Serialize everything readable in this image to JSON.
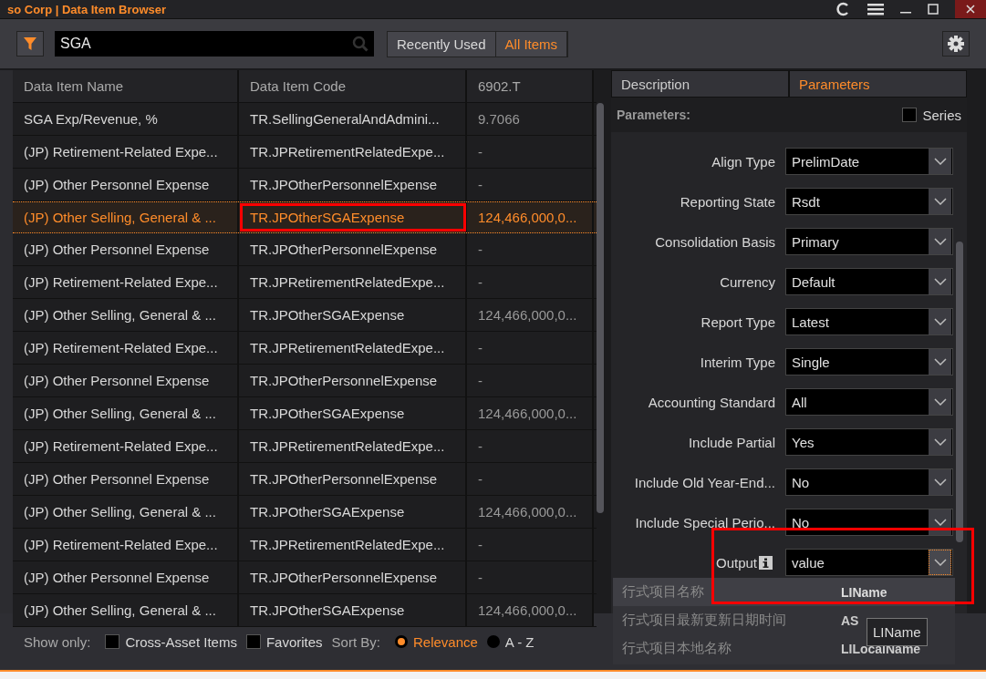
{
  "window": {
    "title": "so Corp | Data Item Browser"
  },
  "search": {
    "value": "SGA"
  },
  "views": [
    {
      "label": "Recently Used",
      "selected": false
    },
    {
      "label": "All Items",
      "selected": true
    }
  ],
  "table": {
    "columns": [
      "Data Item Name",
      "Data Item Code",
      "6902.T"
    ],
    "rows": [
      {
        "cells": [
          "SGA Exp/Revenue, %",
          "TR.SellingGeneralAndAdmini...",
          "9.7066"
        ],
        "selected": false,
        "highlighted": false
      },
      {
        "cells": [
          "(JP) Retirement-Related Expe...",
          "TR.JPRetirementRelatedExpe...",
          "-"
        ],
        "selected": false,
        "highlighted": false
      },
      {
        "cells": [
          "(JP) Other Personnel Expense",
          "TR.JPOtherPersonnelExpense",
          "-"
        ],
        "selected": false,
        "highlighted": false
      },
      {
        "cells": [
          "(JP) Other Selling, General & ...",
          "TR.JPOtherSGAExpense",
          "124,466,000,0..."
        ],
        "selected": true,
        "highlighted": true
      },
      {
        "cells": [
          "(JP) Other Personnel Expense",
          "TR.JPOtherPersonnelExpense",
          "-"
        ],
        "selected": false,
        "highlighted": false
      },
      {
        "cells": [
          "(JP) Retirement-Related Expe...",
          "TR.JPRetirementRelatedExpe...",
          "-"
        ],
        "selected": false,
        "highlighted": false
      },
      {
        "cells": [
          "(JP) Other Selling, General & ...",
          "TR.JPOtherSGAExpense",
          "124,466,000,0..."
        ],
        "selected": false,
        "highlighted": false
      },
      {
        "cells": [
          "(JP) Retirement-Related Expe...",
          "TR.JPRetirementRelatedExpe...",
          "-"
        ],
        "selected": false,
        "highlighted": false
      },
      {
        "cells": [
          "(JP) Other Personnel Expense",
          "TR.JPOtherPersonnelExpense",
          "-"
        ],
        "selected": false,
        "highlighted": false
      },
      {
        "cells": [
          "(JP) Other Selling, General & ...",
          "TR.JPOtherSGAExpense",
          "124,466,000,0..."
        ],
        "selected": false,
        "highlighted": false
      },
      {
        "cells": [
          "(JP) Retirement-Related Expe...",
          "TR.JPRetirementRelatedExpe...",
          "-"
        ],
        "selected": false,
        "highlighted": false
      },
      {
        "cells": [
          "(JP) Other Personnel Expense",
          "TR.JPOtherPersonnelExpense",
          "-"
        ],
        "selected": false,
        "highlighted": false
      },
      {
        "cells": [
          "(JP) Other Selling, General & ...",
          "TR.JPOtherSGAExpense",
          "124,466,000,0..."
        ],
        "selected": false,
        "highlighted": false
      },
      {
        "cells": [
          "(JP) Retirement-Related Expe...",
          "TR.JPRetirementRelatedExpe...",
          "-"
        ],
        "selected": false,
        "highlighted": false
      },
      {
        "cells": [
          "(JP) Other Personnel Expense",
          "TR.JPOtherPersonnelExpense",
          "-"
        ],
        "selected": false,
        "highlighted": false
      },
      {
        "cells": [
          "(JP) Other Selling, General & ...",
          "TR.JPOtherSGAExpense",
          "124,466,000,0..."
        ],
        "selected": false,
        "highlighted": false
      }
    ]
  },
  "detail_tabs": [
    {
      "label": "Description",
      "selected": false
    },
    {
      "label": "Parameters",
      "selected": true
    }
  ],
  "parameters_heading": "Parameters:",
  "series": {
    "label": "Series",
    "checked": false
  },
  "parameters": [
    {
      "label": "Align Type",
      "value": "PrelimDate",
      "info": false,
      "highlighted": false
    },
    {
      "label": "Reporting State",
      "value": "Rsdt",
      "info": false,
      "highlighted": false
    },
    {
      "label": "Consolidation Basis",
      "value": "Primary",
      "info": false,
      "highlighted": false
    },
    {
      "label": "Currency",
      "value": "Default",
      "info": false,
      "highlighted": false
    },
    {
      "label": "Report Type",
      "value": "Latest",
      "info": false,
      "highlighted": false
    },
    {
      "label": "Interim Type",
      "value": "Single",
      "info": false,
      "highlighted": false
    },
    {
      "label": "Accounting Standard",
      "value": "All",
      "info": false,
      "highlighted": false
    },
    {
      "label": "Include Partial",
      "value": "Yes",
      "info": false,
      "highlighted": false
    },
    {
      "label": "Include Old Year-End...",
      "value": "No",
      "info": false,
      "highlighted": false
    },
    {
      "label": "Include Special Perio...",
      "value": "No",
      "info": false,
      "highlighted": false
    },
    {
      "label": "Output",
      "value": "value",
      "info": true,
      "highlighted": true
    }
  ],
  "output_options": [
    {
      "label": "行式项目名称",
      "code": "LIName",
      "selected": true
    },
    {
      "label": "行式项目最新更新日期时间",
      "code": "AS",
      "selected": false
    },
    {
      "label": "行式项目本地名称",
      "code": "LILocalName",
      "selected": false
    }
  ],
  "tooltip": "LIName",
  "show_only": {
    "label": "Show only:",
    "options": [
      {
        "label": "Cross-Asset Items",
        "checked": false
      },
      {
        "label": "Favorites",
        "checked": false
      }
    ]
  },
  "sort": {
    "label": "Sort By:",
    "options": [
      {
        "label": "Relevance",
        "selected": true
      },
      {
        "label": "A - Z",
        "selected": false
      }
    ]
  }
}
